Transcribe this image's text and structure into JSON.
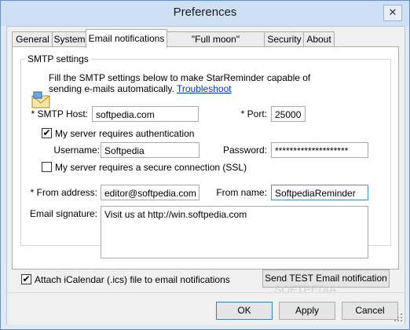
{
  "window": {
    "title": "Preferences",
    "close_glyph": "✕"
  },
  "tabs": [
    {
      "label": "General"
    },
    {
      "label": "System"
    },
    {
      "label": "Email notifications"
    },
    {
      "label": "\"Full moon\" notifications"
    },
    {
      "label": "Security"
    },
    {
      "label": "About"
    }
  ],
  "smtp": {
    "group_label": "SMTP settings",
    "description_line1": "Fill the SMTP settings below to make StarReminder capable of",
    "description_line2": "sending e-mails automatically.",
    "troubleshoot_link": "Troubleshoot",
    "host_label": "* SMTP Host:",
    "host_value": "softpedia.com",
    "port_label": "* Port:",
    "port_value": "25000",
    "auth_label": "My server requires authentication",
    "auth_checked": true,
    "check_glyph": "✔",
    "username_label": "Username:",
    "username_value": "Softpedia",
    "password_label": "Password:",
    "password_value": "********************",
    "secure_label": "My server requires a secure connection (SSL)",
    "secure_checked": false,
    "from_address_label": "* From address:",
    "from_address_value": "editor@softpedia.com",
    "from_name_label": "From name:",
    "from_name_value": "SoftpediaReminder",
    "signature_label": "Email signature:",
    "signature_value": "Visit us at http://win.softpedia.com"
  },
  "attach_ical": {
    "label": "Attach iCalendar (.ics) file to email notifications",
    "checked": true
  },
  "buttons": {
    "test": "Send TEST Email notification",
    "ok": "OK",
    "apply": "Apply",
    "cancel": "Cancel"
  },
  "watermark": "SOFTPEDIA",
  "icons": [
    "mail-settings-icon",
    "close-icon",
    "check-icon",
    "resize-grip-icon"
  ]
}
